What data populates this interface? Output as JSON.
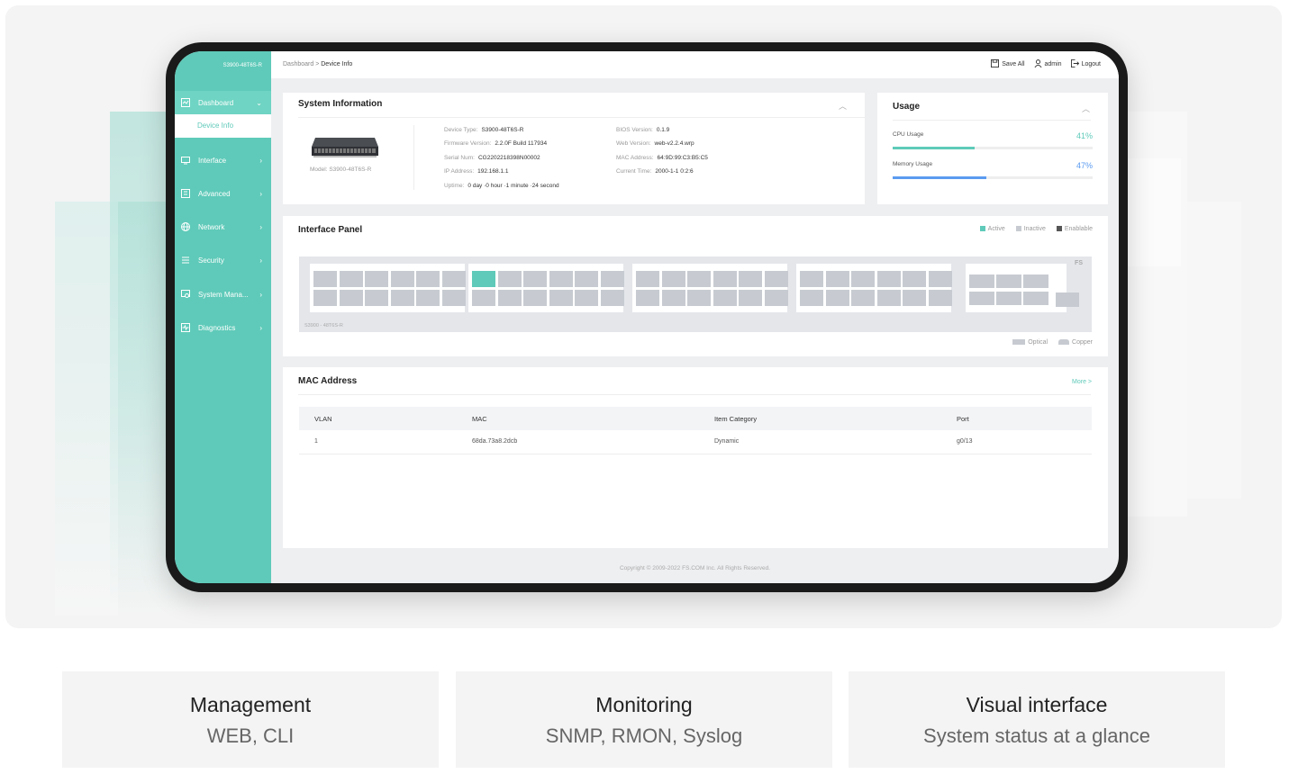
{
  "sidebar": {
    "device_label": "S3900-48T6S-R",
    "items": [
      {
        "label": "Dashboard"
      },
      {
        "label": "Interface"
      },
      {
        "label": "Advanced"
      },
      {
        "label": "Network"
      },
      {
        "label": "Security"
      },
      {
        "label": "System Mana..."
      },
      {
        "label": "Diagnostics"
      }
    ],
    "sub_item": "Device Info"
  },
  "header": {
    "breadcrumb_root": "Dashboard",
    "breadcrumb_sep": ">",
    "breadcrumb_current": "Device Info",
    "save_all": "Save All",
    "user": "admin",
    "logout": "Logout"
  },
  "system_info": {
    "title": "System Information",
    "model_label": "Model: S3900-48T6S-R",
    "device_type_label": "Device Type:",
    "device_type": "S3900-48T6S-R",
    "firmware_label": "Firmware Version:",
    "firmware": "2.2.0F Build 117934",
    "serial_label": "Serial Num:",
    "serial": "CG2202218398N00002",
    "ip_label": "IP Address:",
    "ip": "192.168.1.1",
    "uptime_label": "Uptime:",
    "uptime": "0 day ·0 hour ·1 minute ·24 second",
    "bios_label": "BIOS Version:",
    "bios": "0.1.9",
    "web_label": "Web Version:",
    "web": "web-v2.2.4.wrp",
    "mac_label": "MAC Address:",
    "mac": "64:9D:99:C3:B5:C5",
    "time_label": "Current Time:",
    "time": "2000-1-1 0:2:6"
  },
  "usage": {
    "title": "Usage",
    "cpu_label": "CPU Usage",
    "cpu_value": "41%",
    "cpu_fraction": 0.41,
    "mem_label": "Memory Usage",
    "mem_value": "47%",
    "mem_fraction": 0.47
  },
  "interface_panel": {
    "title": "Interface Panel",
    "legend_active": "Active",
    "legend_inactive": "Inactive",
    "legend_enable": "Enablable",
    "legend_optical": "Optical",
    "legend_copper": "Copper",
    "panel_model": "S3900 - 48T6S-R",
    "brand": "FS",
    "active_port": 13
  },
  "mac_table": {
    "title": "MAC Address",
    "more": "More >",
    "headers": [
      "VLAN",
      "MAC",
      "Item Category",
      "Port"
    ],
    "rows": [
      [
        "1",
        "68da.73a8.2dcb",
        "Dynamic",
        "g0/13"
      ]
    ]
  },
  "footer": {
    "copyright": "Copyright © 2009-2022 FS.COM Inc. All Rights Reserved."
  },
  "features": [
    {
      "title": "Management",
      "subtitle": "WEB, CLI"
    },
    {
      "title": "Monitoring",
      "subtitle": "SNMP, RMON, Syslog"
    },
    {
      "title": "Visual interface",
      "subtitle": "System status at a glance"
    }
  ],
  "colors": {
    "accent": "#5fcab9",
    "cpu_bar": "#5fcab9",
    "mem_bar": "#5b9bf0"
  }
}
